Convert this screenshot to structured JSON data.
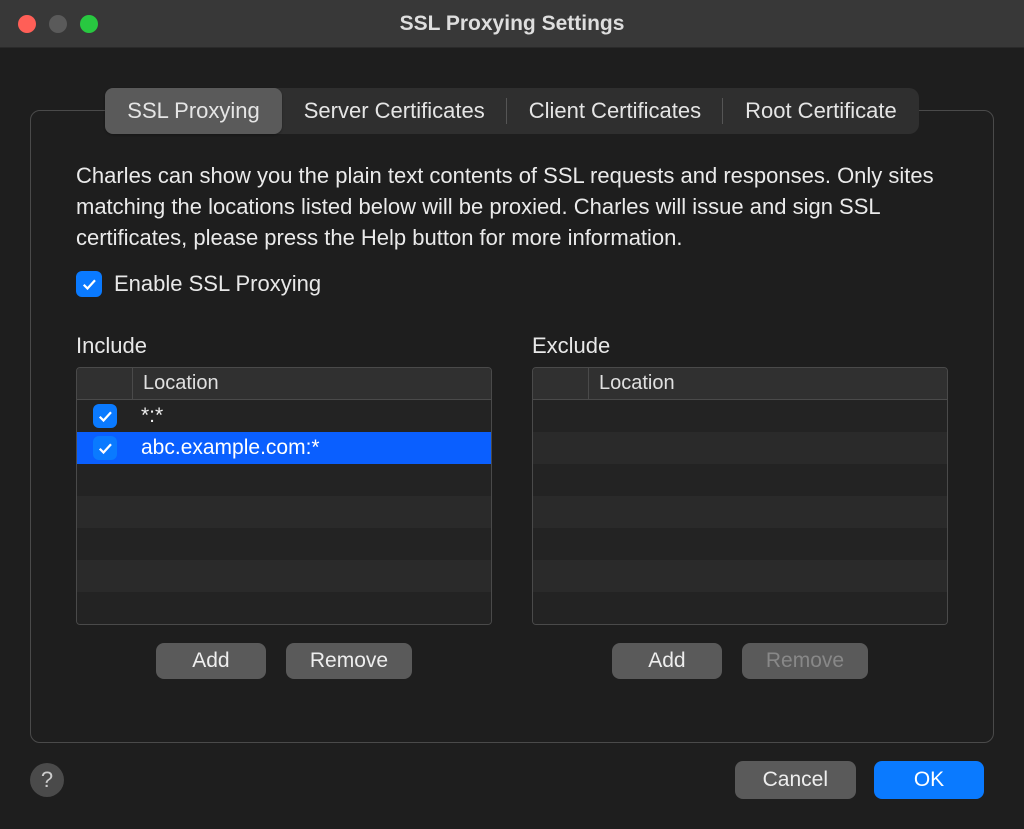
{
  "window": {
    "title": "SSL Proxying Settings"
  },
  "tabs": {
    "items": [
      "SSL Proxying",
      "Server Certificates",
      "Client Certificates",
      "Root Certificate"
    ],
    "active_index": 0
  },
  "panel": {
    "description": "Charles can show you the plain text contents of SSL requests and responses. Only sites matching the locations listed below will be proxied. Charles will issue and sign SSL certificates, please press the Help button for more information.",
    "enable_label": "Enable SSL Proxying",
    "enable_checked": true
  },
  "include": {
    "title": "Include",
    "header": "Location",
    "rows": [
      {
        "checked": true,
        "location": "*:*",
        "selected": false
      },
      {
        "checked": true,
        "location": "abc.example.com:*",
        "selected": true
      }
    ],
    "add_label": "Add",
    "remove_label": "Remove",
    "remove_disabled": false
  },
  "exclude": {
    "title": "Exclude",
    "header": "Location",
    "rows": [],
    "add_label": "Add",
    "remove_label": "Remove",
    "remove_disabled": true
  },
  "footer": {
    "help_label": "?",
    "cancel_label": "Cancel",
    "ok_label": "OK"
  }
}
